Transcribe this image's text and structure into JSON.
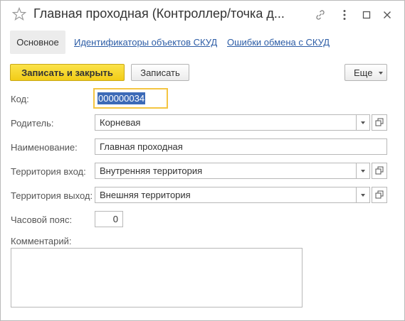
{
  "window": {
    "title": "Главная проходная (Контроллер/точка д..."
  },
  "tabs": [
    {
      "label": "Основное",
      "active": true
    },
    {
      "label": "Идентификаторы объектов СКУД",
      "active": false
    },
    {
      "label": "Ошибки обмена с СКУД",
      "active": false
    }
  ],
  "toolbar": {
    "save_close_label": "Записать и закрыть",
    "save_label": "Записать",
    "more_label": "Еще"
  },
  "form": {
    "code_label": "Код:",
    "code_value": "000000034",
    "parent_label": "Родитель:",
    "parent_value": "Корневая",
    "name_label": "Наименование:",
    "name_value": "Главная проходная",
    "territory_in_label": "Территория вход:",
    "territory_in_value": "Внутренняя территория",
    "territory_out_label": "Территория выход:",
    "territory_out_value": "Внешняя территория",
    "timezone_label": "Часовой пояс:",
    "timezone_value": "0",
    "comment_label": "Комментарий:",
    "comment_value": ""
  },
  "colors": {
    "accent_yellow": "#f2cc17",
    "focus_border": "#f4c542",
    "link": "#2d5da6",
    "selection": "#3c6ab7"
  }
}
